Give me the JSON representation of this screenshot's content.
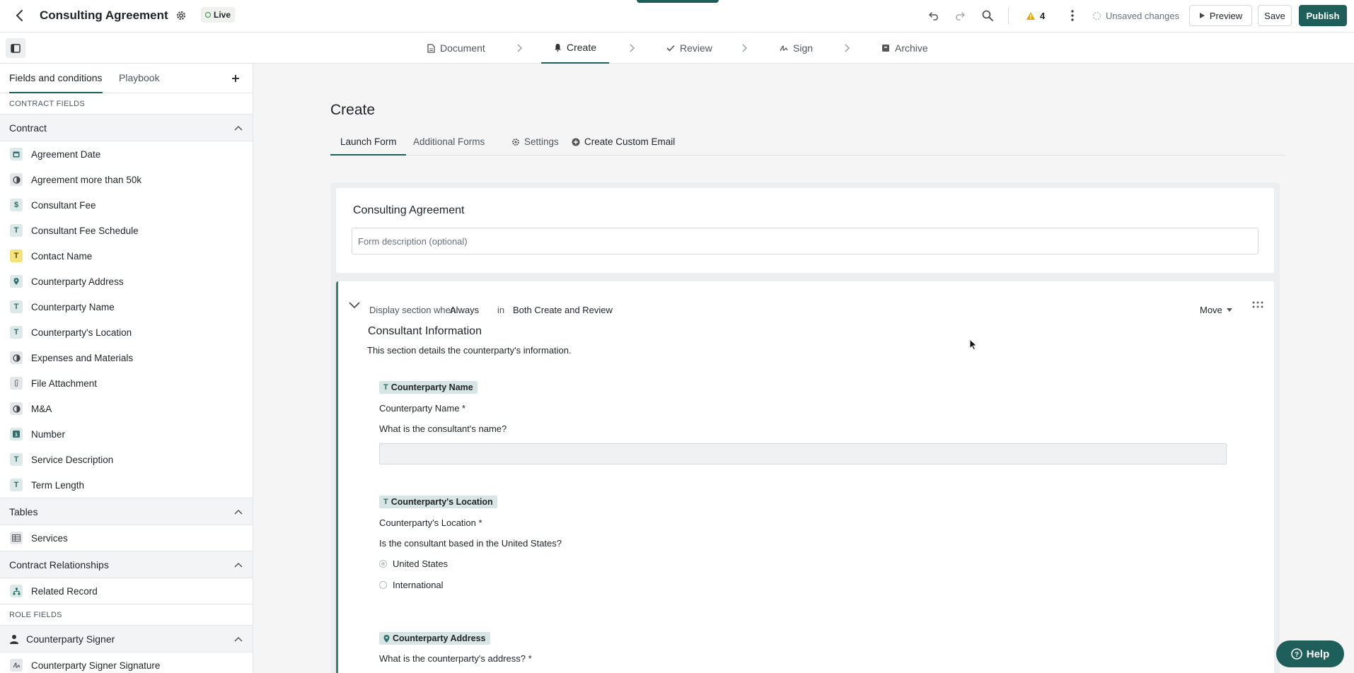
{
  "header": {
    "title": "Consulting Agreement",
    "status": "Live",
    "warnings_count": "4",
    "unsaved": "Unsaved changes",
    "preview": "Preview",
    "save": "Save",
    "publish": "Publish"
  },
  "steps": [
    "Document",
    "Create",
    "Review",
    "Sign",
    "Archive"
  ],
  "sidebar": {
    "tabs": [
      "Fields and conditions",
      "Playbook"
    ],
    "contract_fields_label": "CONTRACT FIELDS",
    "contract_group": "Contract",
    "contract_items": [
      {
        "label": "Agreement Date",
        "icon": "calendar-icon"
      },
      {
        "label": "Agreement more than 50k",
        "icon": "condition-icon"
      },
      {
        "label": "Consultant Fee",
        "icon": "dollar-icon"
      },
      {
        "label": "Consultant Fee Schedule",
        "icon": "text-icon"
      },
      {
        "label": "Contact Name",
        "icon": "text-icon"
      },
      {
        "label": "Counterparty Address",
        "icon": "location-icon"
      },
      {
        "label": "Counterparty Name",
        "icon": "text-icon"
      },
      {
        "label": "Counterparty's Location",
        "icon": "text-icon"
      },
      {
        "label": "Expenses and Materials",
        "icon": "condition-icon"
      },
      {
        "label": "File Attachment",
        "icon": "paperclip-icon"
      },
      {
        "label": "M&A",
        "icon": "condition-icon"
      },
      {
        "label": "Number",
        "icon": "number-icon"
      },
      {
        "label": "Service Description",
        "icon": "text-icon"
      },
      {
        "label": "Term Length",
        "icon": "text-icon"
      }
    ],
    "tables_group": "Tables",
    "tables_items": [
      {
        "label": "Services",
        "icon": "table-icon"
      }
    ],
    "relationships_group": "Contract Relationships",
    "relationships_items": [
      {
        "label": "Related Record",
        "icon": "hierarchy-icon"
      }
    ],
    "role_fields_label": "ROLE FIELDS",
    "role_group": "Counterparty Signer",
    "role_items": [
      {
        "label": "Counterparty Signer Signature",
        "icon": "signature-icon"
      }
    ]
  },
  "main": {
    "title": "Create",
    "tabs": [
      "Launch Form",
      "Additional Forms",
      "Settings",
      "Create Custom Email"
    ],
    "form_title": "Consulting Agreement",
    "form_description_placeholder": "Form description (optional)",
    "section": {
      "cond_prefix": "Display section when",
      "cond_value": "Always",
      "cond_in": "in",
      "cond_scope": "Both Create and Review",
      "move": "Move",
      "title": "Consultant Information",
      "description": "This section details the counterparty's information.",
      "fields": [
        {
          "tag": "Counterparty Name",
          "label": "Counterparty Name *",
          "question": "What is the consultant's name?"
        },
        {
          "tag": "Counterparty's Location",
          "label": "Counterparty's Location *",
          "question": "Is the consultant based in the United States?",
          "options": [
            "United States",
            "International"
          ]
        },
        {
          "tag": "Counterparty Address",
          "question": "What is the counterparty's address? *"
        }
      ]
    }
  },
  "help": "Help",
  "colors": {
    "brand": "#1f5f5b",
    "section_accent": "#2f8a6b",
    "tag_bg": "#d7e6e4",
    "warning": "#e0a800"
  }
}
